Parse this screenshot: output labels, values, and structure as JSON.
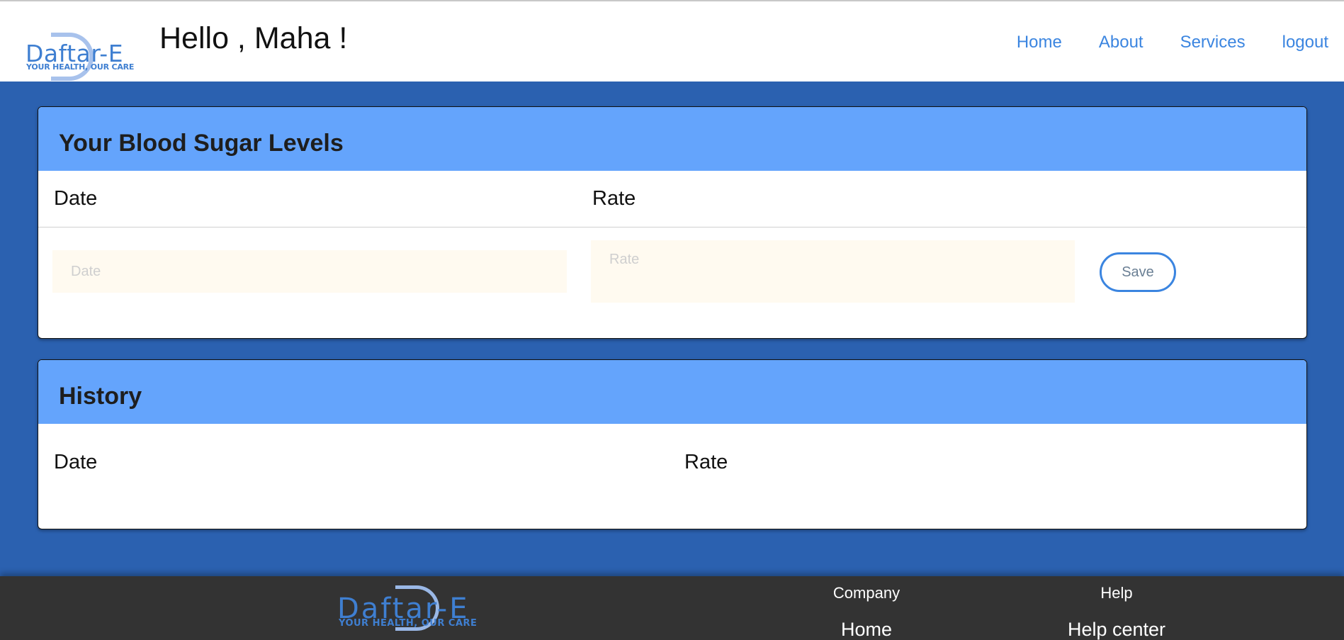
{
  "header": {
    "logo": {
      "name": "Daftar-E",
      "tagline": "YOUR HEALTH, OUR CARE"
    },
    "greeting": "Hello , Maha !",
    "nav": [
      "Home",
      "About",
      "Services",
      "logout"
    ]
  },
  "blood_sugar_card": {
    "title": "Your Blood Sugar Levels",
    "columns": [
      "Date",
      "Rate"
    ],
    "date_input": {
      "value": "",
      "placeholder": "Date"
    },
    "rate_input": {
      "value": "",
      "placeholder": "Rate"
    },
    "save_label": "Save"
  },
  "history_card": {
    "title": "History",
    "columns": [
      "Date",
      "Rate"
    ]
  },
  "footer": {
    "logo": {
      "name": "Daftar-E",
      "tagline": "YOUR HEALTH, OUR CARE"
    },
    "columns": [
      {
        "title": "Company",
        "first_link": "Home"
      },
      {
        "title": "Help",
        "first_link": "Help center"
      }
    ]
  },
  "colors": {
    "page_background": "#2b61b0",
    "card_header": "#64a4fc",
    "nav_link": "#3b85e0",
    "footer_background": "#333333"
  }
}
